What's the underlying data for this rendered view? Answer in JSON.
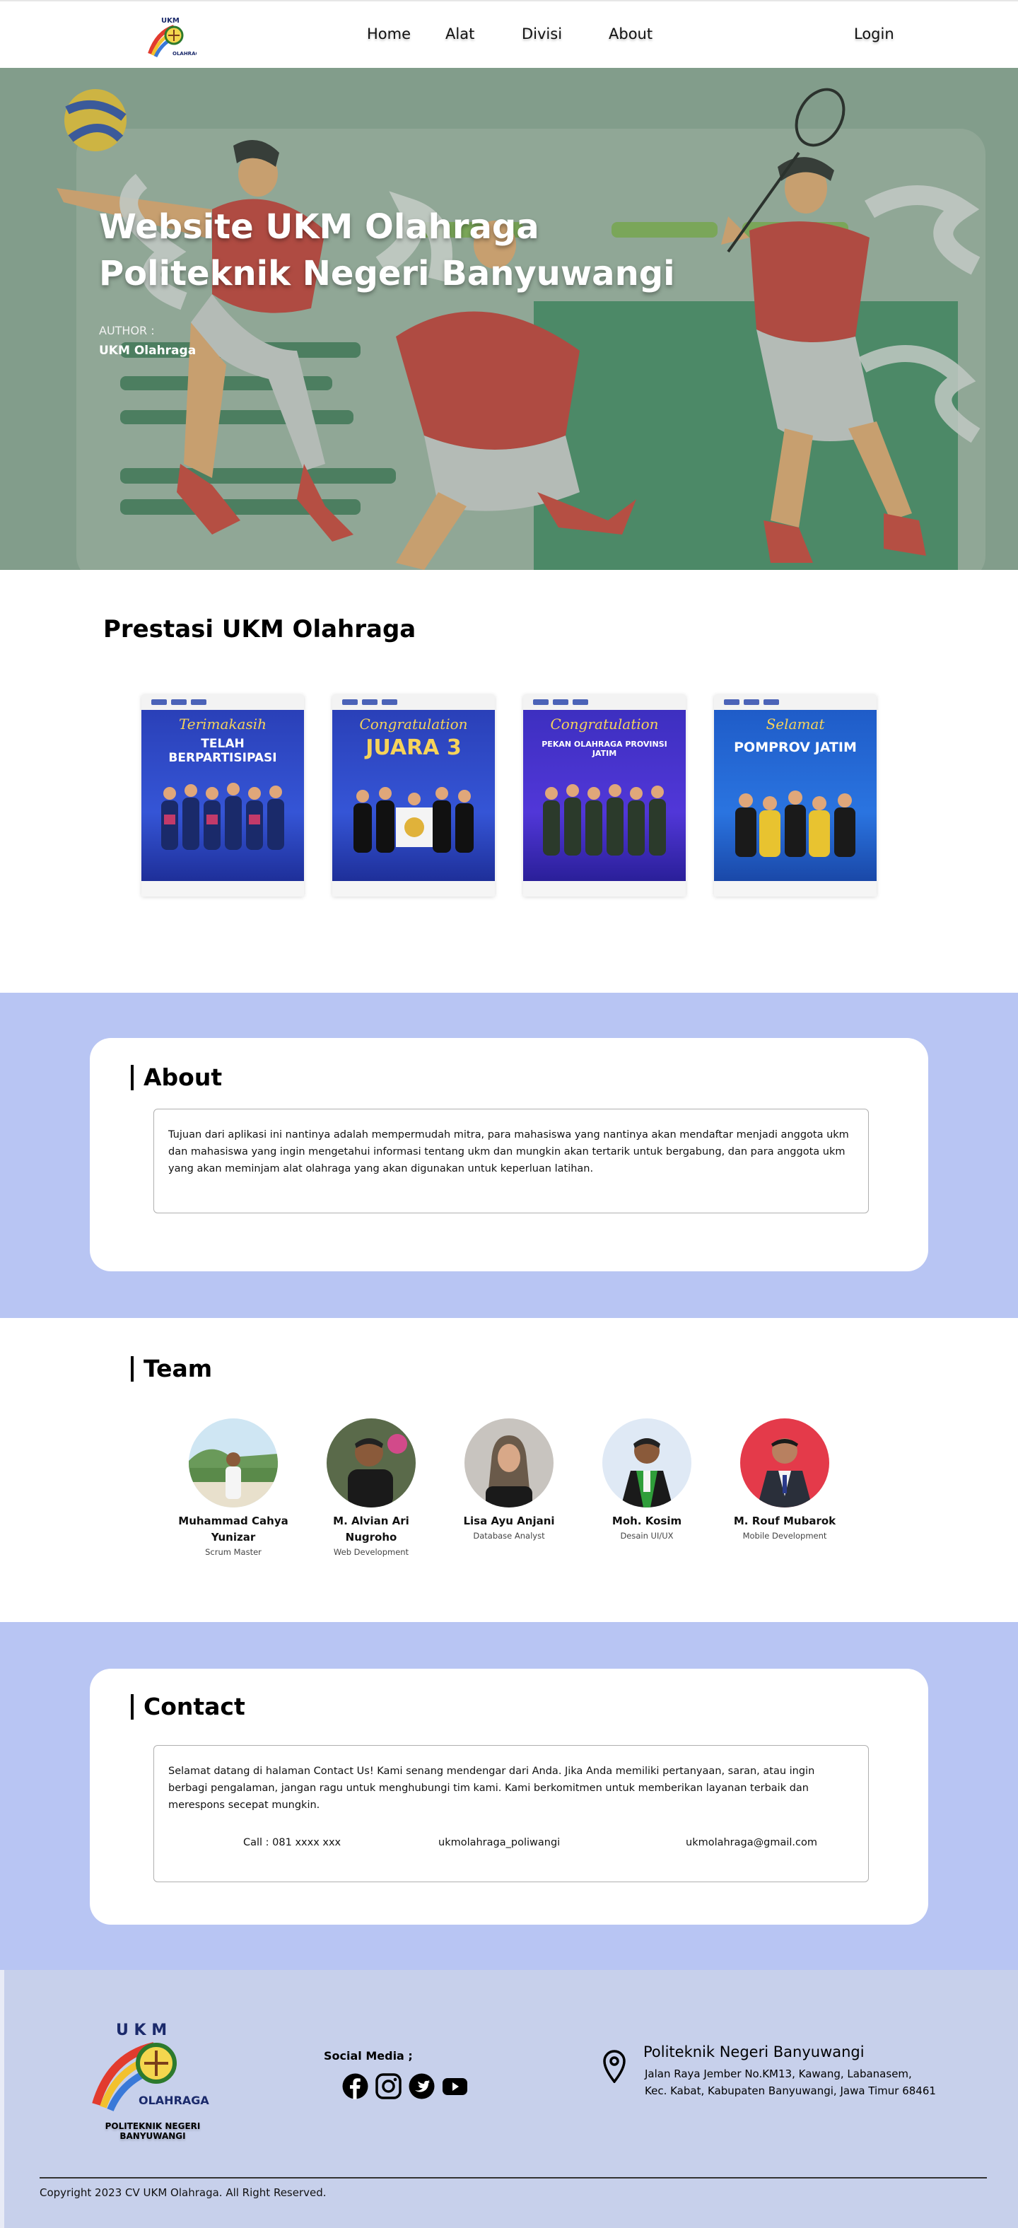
{
  "nav": {
    "logo_text_top": "UKM",
    "logo_text_bottom": "OLAHRAGA",
    "links": [
      "Home",
      "Alat",
      "Divisi",
      "About"
    ],
    "login": "Login"
  },
  "hero": {
    "title_line1": "Website UKM Olahraga",
    "title_line2": "Politeknik Negeri Banyuwangi",
    "author_label": "AUTHOR :",
    "author_name": "UKM Olahraga"
  },
  "prestasi": {
    "title": "Prestasi UKM Olahraga",
    "posters": [
      {
        "line1": "Terimakasih",
        "line2": "TELAH BERPARTISIPASI"
      },
      {
        "line1": "Congratulation",
        "line2": "JUARA 3"
      },
      {
        "line1": "Congratulation",
        "line2": "PEKAN OLAHRAGA PROVINSI JATIM"
      },
      {
        "line1": "Selamat",
        "line2": "POMPROV JATIM"
      }
    ]
  },
  "about": {
    "title": "About",
    "text": "Tujuan dari aplikasi ini nantinya adalah mempermudah mitra, para mahasiswa yang nantinya akan mendaftar menjadi anggota ukm dan mahasiswa yang ingin mengetahui informasi tentang ukm dan mungkin akan tertarik untuk bergabung, dan para anggota ukm yang akan meminjam alat olahraga yang akan digunakan untuk keperluan latihan."
  },
  "team": {
    "title": "Team",
    "members": [
      {
        "name": "Muhammad Cahya Yunizar",
        "role": "Scrum Master"
      },
      {
        "name": "M. Alvian Ari Nugroho",
        "role": "Web Development"
      },
      {
        "name": "Lisa Ayu Anjani",
        "role": "Database Analyst"
      },
      {
        "name": "Moh. Kosim",
        "role": "Desain UI/UX"
      },
      {
        "name": "M. Rouf Mubarok",
        "role": "Mobile Development"
      }
    ]
  },
  "contact": {
    "title": "Contact",
    "text": "Selamat datang di halaman Contact Us! Kami senang mendengar dari Anda. Jika Anda memiliki pertanyaan, saran, atau ingin berbagi pengalaman, jangan ragu untuk menghubungi tim kami. Kami berkomitmen untuk memberikan layanan terbaik dan merespons secepat mungkin.",
    "phone": "Call : 081 xxxx xxx",
    "instagram": "ukmolahraga_poliwangi",
    "email": "ukmolahraga@gmail.com"
  },
  "footer": {
    "logo_caption": "POLITEKNIK NEGERI BANYUWANGI",
    "social_label": "Social Media ;",
    "social_icons": [
      "facebook-icon",
      "instagram-icon",
      "twitter-icon",
      "youtube-icon"
    ],
    "address_title": "Politeknik Negeri Banyuwangi",
    "address_line1": "Jalan Raya Jember No.KM13, Kawang, Labanasem,",
    "address_line2": "Kec. Kabat, Kabupaten Banyuwangi, Jawa Timur 68461",
    "copyright": "Copyright 2023 CV UKM Olahraga. All Right Reserved."
  },
  "colors": {
    "band": "#b8c5f3",
    "footer": "#c7d0eb",
    "hero_green": "#88a592",
    "jersey_red": "#c8342e"
  }
}
